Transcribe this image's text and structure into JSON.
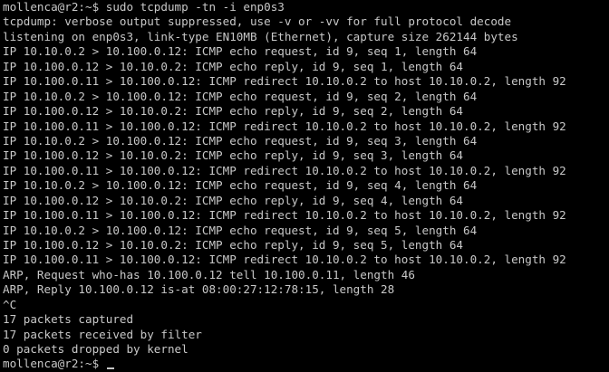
{
  "terminal": {
    "command_prompt": "mollenca@r2:~$ sudo tcpdump -tn -i enp0s3",
    "output_lines": [
      "tcpdump: verbose output suppressed, use -v or -vv for full protocol decode",
      "listening on enp0s3, link-type EN10MB (Ethernet), capture size 262144 bytes",
      "IP 10.10.0.2 > 10.100.0.12: ICMP echo request, id 9, seq 1, length 64",
      "IP 10.100.0.12 > 10.10.0.2: ICMP echo reply, id 9, seq 1, length 64",
      "IP 10.100.0.11 > 10.100.0.12: ICMP redirect 10.10.0.2 to host 10.10.0.2, length 92",
      "IP 10.10.0.2 > 10.100.0.12: ICMP echo request, id 9, seq 2, length 64",
      "IP 10.100.0.12 > 10.10.0.2: ICMP echo reply, id 9, seq 2, length 64",
      "IP 10.100.0.11 > 10.100.0.12: ICMP redirect 10.10.0.2 to host 10.10.0.2, length 92",
      "IP 10.10.0.2 > 10.100.0.12: ICMP echo request, id 9, seq 3, length 64",
      "IP 10.100.0.12 > 10.10.0.2: ICMP echo reply, id 9, seq 3, length 64",
      "IP 10.100.0.11 > 10.100.0.12: ICMP redirect 10.10.0.2 to host 10.10.0.2, length 92",
      "IP 10.10.0.2 > 10.100.0.12: ICMP echo request, id 9, seq 4, length 64",
      "IP 10.100.0.12 > 10.10.0.2: ICMP echo reply, id 9, seq 4, length 64",
      "IP 10.100.0.11 > 10.100.0.12: ICMP redirect 10.10.0.2 to host 10.10.0.2, length 92",
      "IP 10.10.0.2 > 10.100.0.12: ICMP echo request, id 9, seq 5, length 64",
      "IP 10.100.0.12 > 10.10.0.2: ICMP echo reply, id 9, seq 5, length 64",
      "IP 10.100.0.11 > 10.100.0.12: ICMP redirect 10.10.0.2 to host 10.10.0.2, length 92",
      "ARP, Request who-has 10.100.0.12 tell 10.100.0.11, length 46",
      "ARP, Reply 10.100.0.12 is-at 08:00:27:12:78:15, length 28",
      "^C",
      "17 packets captured",
      "17 packets received by filter",
      "0 packets dropped by kernel"
    ],
    "final_prompt": "mollenca@r2:~$ ",
    "colors": {
      "background": "#000000",
      "text": "#c8c8c8"
    }
  }
}
